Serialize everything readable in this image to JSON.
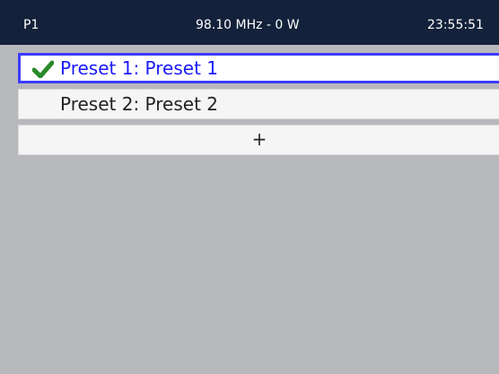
{
  "status_bar": {
    "left": "P1",
    "center": "98.10 MHz - 0 W",
    "right": "23:55:51"
  },
  "presets": [
    {
      "label": "Preset 1: Preset 1",
      "selected": true
    },
    {
      "label": "Preset 2: Preset 2",
      "selected": false
    }
  ],
  "add_button": {
    "label": "+"
  },
  "colors": {
    "status_bar_bg": "#13213a",
    "background": "#b8b9bd",
    "selected_border": "#3c3cff",
    "selected_text": "#1a1aff",
    "check": "#2a8a2a"
  },
  "icons": {
    "selected_marker": "check-icon"
  }
}
